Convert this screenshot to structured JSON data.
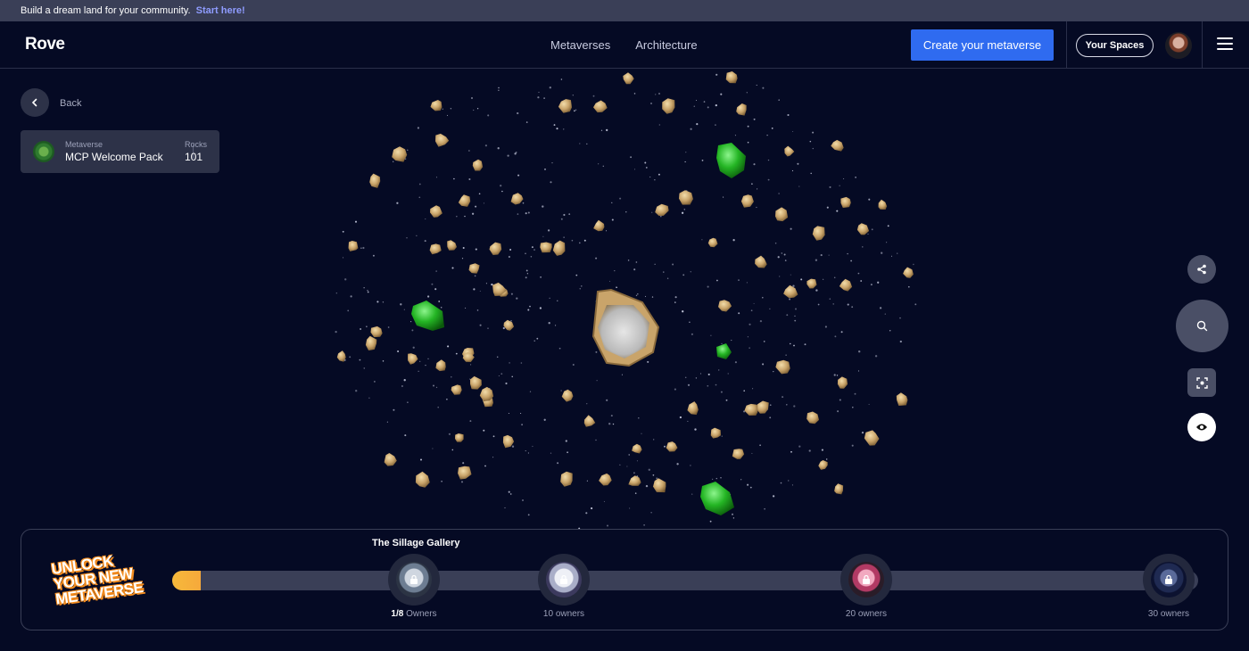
{
  "announcement": {
    "text": "Build a dream land for your community.",
    "link": "Start here!"
  },
  "header": {
    "logo": "Rove",
    "nav": [
      "Metaverses",
      "Architecture"
    ],
    "create_label": "Create your metaverse",
    "spaces_label": "Your Spaces"
  },
  "back": {
    "label": "Back"
  },
  "metaverse_card": {
    "kicker": "Metaverse",
    "name": "MCP Welcome Pack",
    "rocks_kicker": "Rocks",
    "rocks_value": "101"
  },
  "side_controls": [
    "share-icon",
    "search-icon",
    "focus-icon",
    "eye-icon"
  ],
  "unlock": {
    "logo_lines": [
      "UNLOCK",
      "YOUR NEW",
      "METAVERSE"
    ],
    "gallery_title": "The Sillage Gallery",
    "progress": 0.028,
    "milestones": [
      {
        "label_strong": "1/8",
        "label_rest": " Owners"
      },
      {
        "label_strong": "",
        "label_rest": "10 owners"
      },
      {
        "label_strong": "",
        "label_rest": "20 owners"
      },
      {
        "label_strong": "",
        "label_rest": "30 owners"
      }
    ]
  },
  "colors": {
    "accent": "#2f6bf0",
    "background": "#050a24",
    "rock": "#c9a46a",
    "gem": "#2fb52f",
    "progress": "#f6b93b"
  }
}
